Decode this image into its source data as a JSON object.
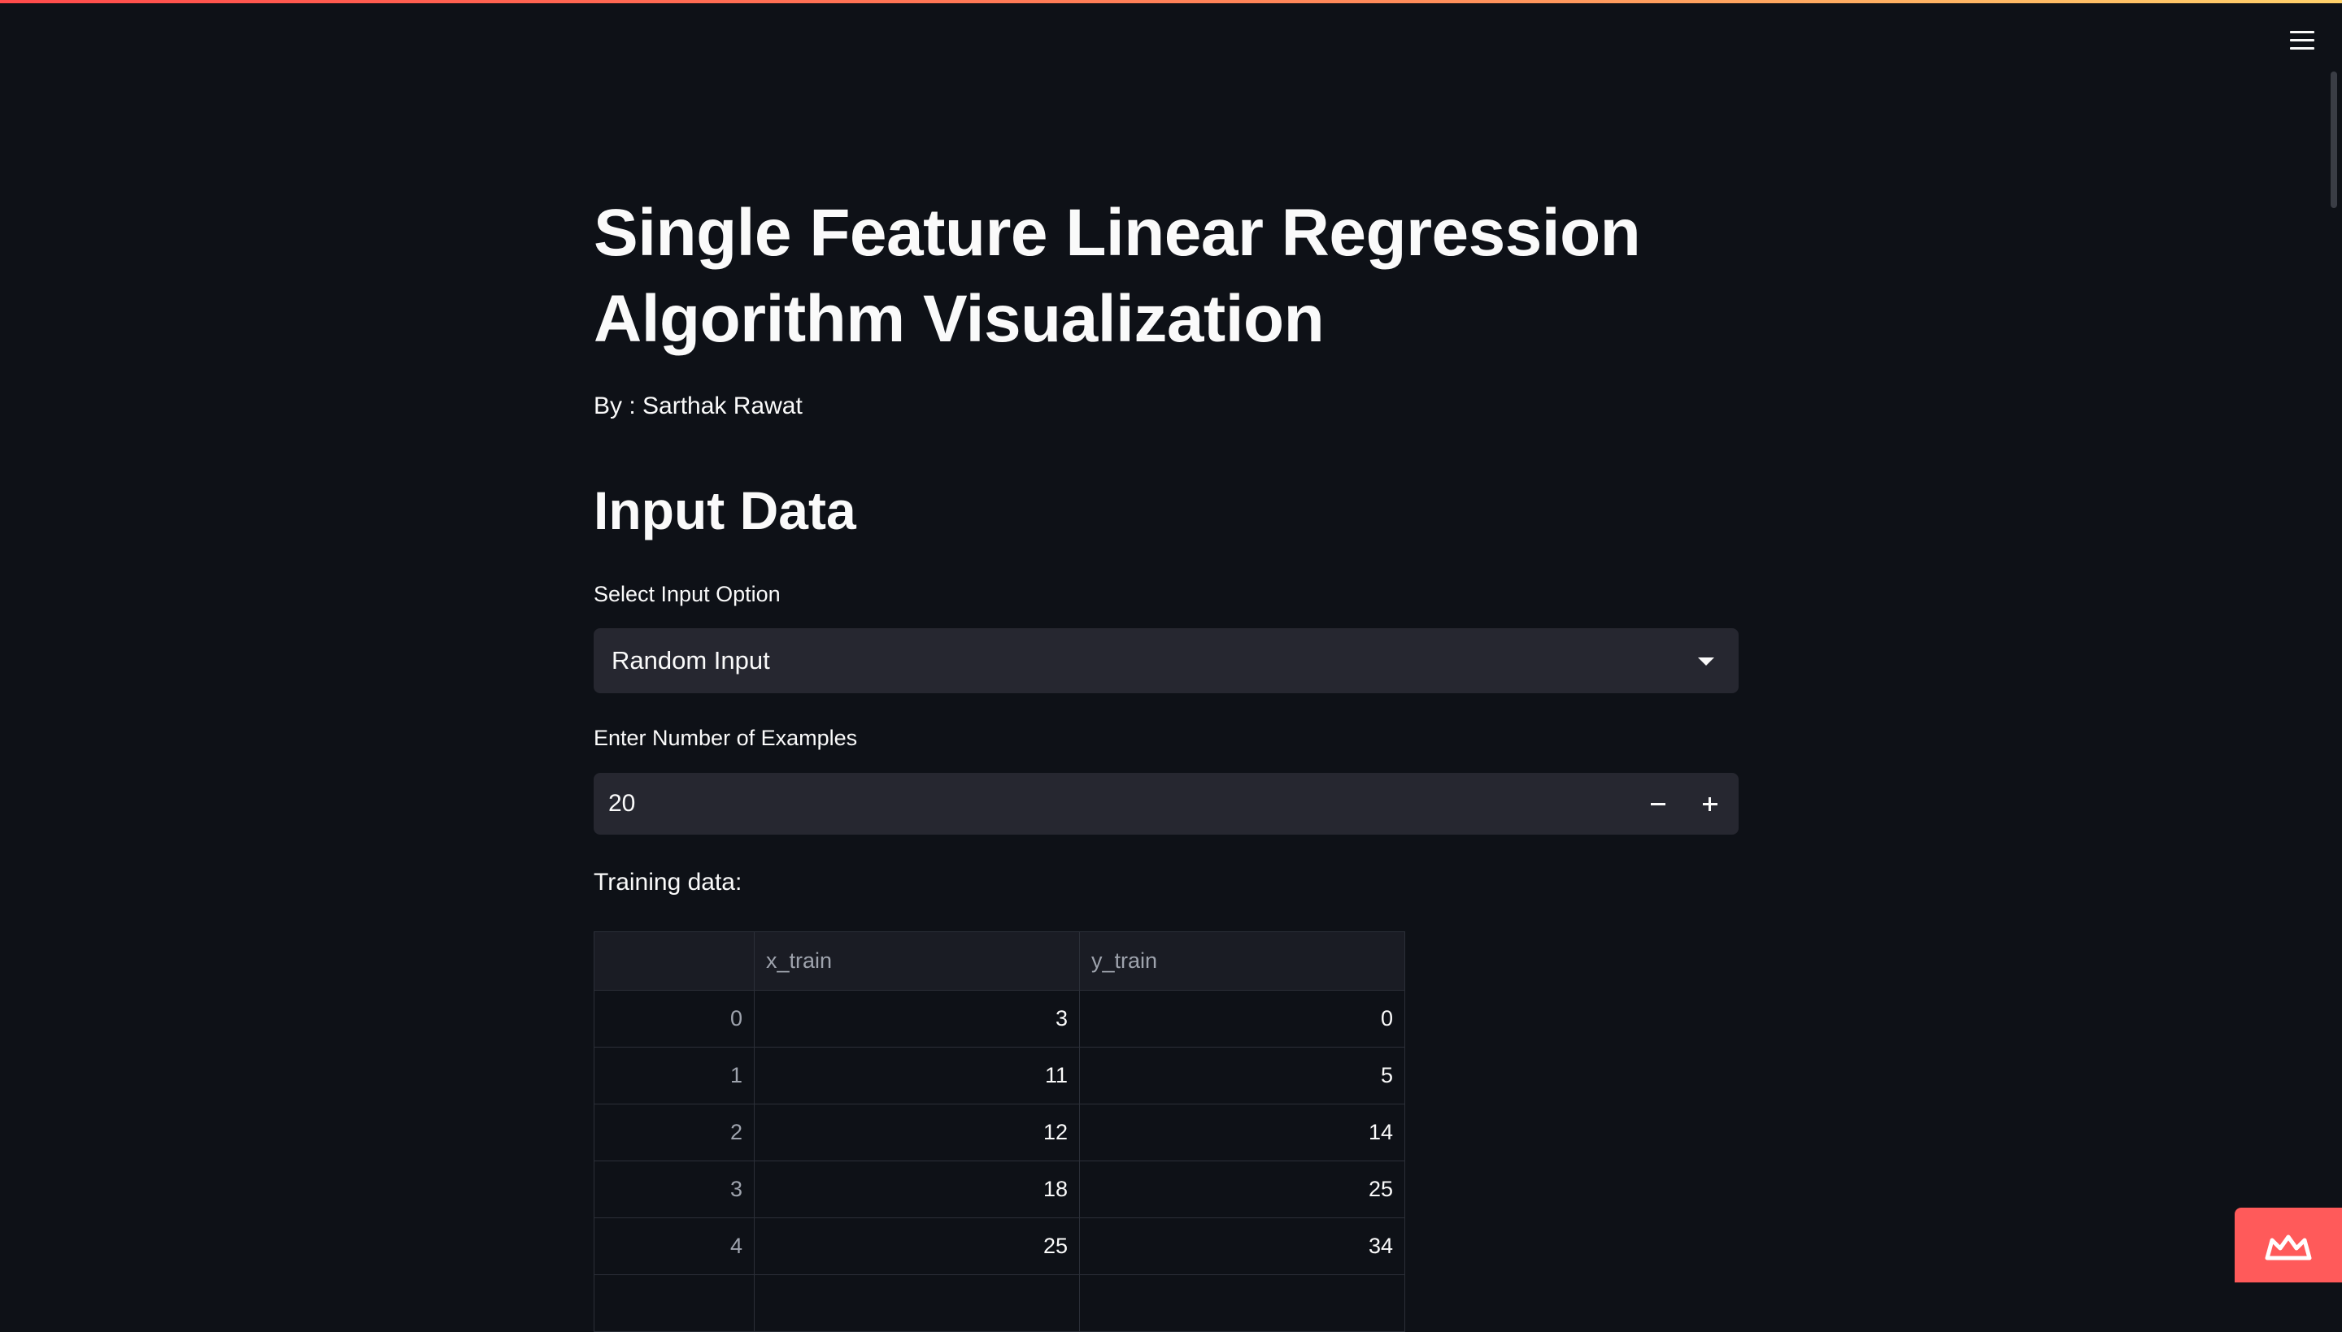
{
  "app": {
    "title": "Single Feature Linear Regression Algorithm Visualization",
    "author": "By : Sarthak Rawat",
    "accent_color": "#ff4b4b"
  },
  "header": {
    "menu_icon": "hamburger-menu-icon"
  },
  "input_section": {
    "heading": "Input Data",
    "select_label": "Select Input Option",
    "select_value": "Random Input",
    "number_label": "Enter Number of Examples",
    "number_value": "20",
    "training_label": "Training data:"
  },
  "table": {
    "columns": [
      "",
      "x_train",
      "y_train"
    ],
    "rows": [
      {
        "index": "0",
        "x_train": "3",
        "y_train": "0"
      },
      {
        "index": "1",
        "x_train": "11",
        "y_train": "5"
      },
      {
        "index": "2",
        "x_train": "12",
        "y_train": "14"
      },
      {
        "index": "3",
        "x_train": "18",
        "y_train": "25"
      },
      {
        "index": "4",
        "x_train": "25",
        "y_train": "34"
      },
      {
        "index": "",
        "x_train": "",
        "y_train": ""
      }
    ]
  },
  "footer": {
    "badge_icon": "streamlit-crown-icon"
  }
}
